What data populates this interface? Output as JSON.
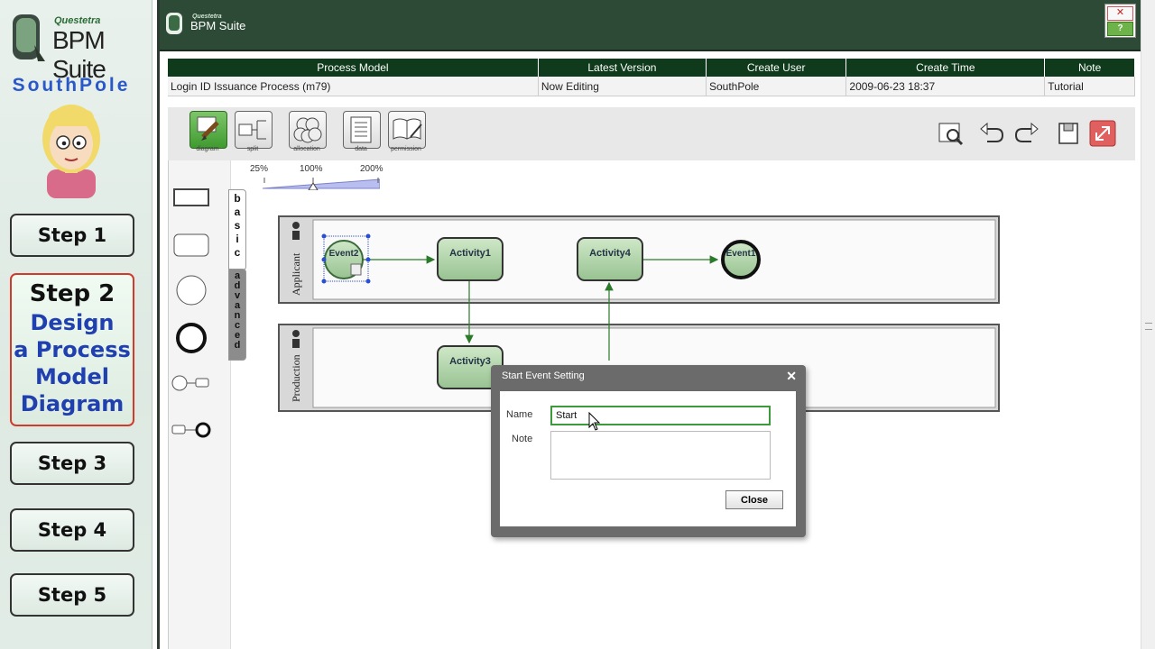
{
  "sidebar": {
    "brand_small": "Questetra",
    "brand": "BPM Suite",
    "user": "SouthPole",
    "steps": [
      {
        "title": "Step 1"
      },
      {
        "title": "Step 2",
        "desc": [
          "Design",
          "a Process",
          "Model",
          "Diagram"
        ]
      },
      {
        "title": "Step 3"
      },
      {
        "title": "Step 4"
      },
      {
        "title": "Step 5"
      }
    ]
  },
  "window": {
    "brand_small": "Questetra",
    "title": "BPM Suite",
    "close_icon": "close-icon",
    "help_label": "?"
  },
  "info_table": {
    "headers": [
      "Process Model",
      "Latest Version",
      "Create User",
      "Create Time",
      "Note"
    ],
    "row": [
      "Login ID Issuance Process (m79)",
      "Now Editing",
      "SouthPole",
      "2009-06-23 18:37",
      "Tutorial"
    ]
  },
  "toolbar": {
    "tools": [
      {
        "label": "diagram",
        "icon": "diagram-icon",
        "active": true
      },
      {
        "label": "split",
        "icon": "split-icon"
      },
      {
        "label": "allocation",
        "icon": "allocation-icon"
      },
      {
        "label": "data",
        "icon": "data-icon"
      },
      {
        "label": "permission",
        "icon": "permission-icon"
      }
    ],
    "right_tools": [
      "preview-icon",
      "undo-icon",
      "redo-icon",
      "save-icon",
      "expand-icon"
    ]
  },
  "zoom": {
    "labels": [
      "25%",
      "100%",
      "200%"
    ],
    "value_percent": 100
  },
  "palette_tabs": {
    "basic": "basic",
    "advanced": "advanced"
  },
  "diagram": {
    "lanes": [
      "Applicant",
      "Production"
    ],
    "nodes": {
      "event2": "Event2",
      "activity1": "Activity1",
      "activity4": "Activity4",
      "event1": "Event1",
      "activity3": "Activity3"
    }
  },
  "dialog": {
    "title": "Start Event Setting",
    "name_label": "Name",
    "name_value": "Start",
    "note_label": "Note",
    "note_value": "",
    "close_label": "Close"
  },
  "colors": {
    "header_green": "#0f3a1c",
    "title_green": "#2c4a36",
    "accent_blue": "#2a58c8",
    "node_fill": "#a9cfa3"
  }
}
